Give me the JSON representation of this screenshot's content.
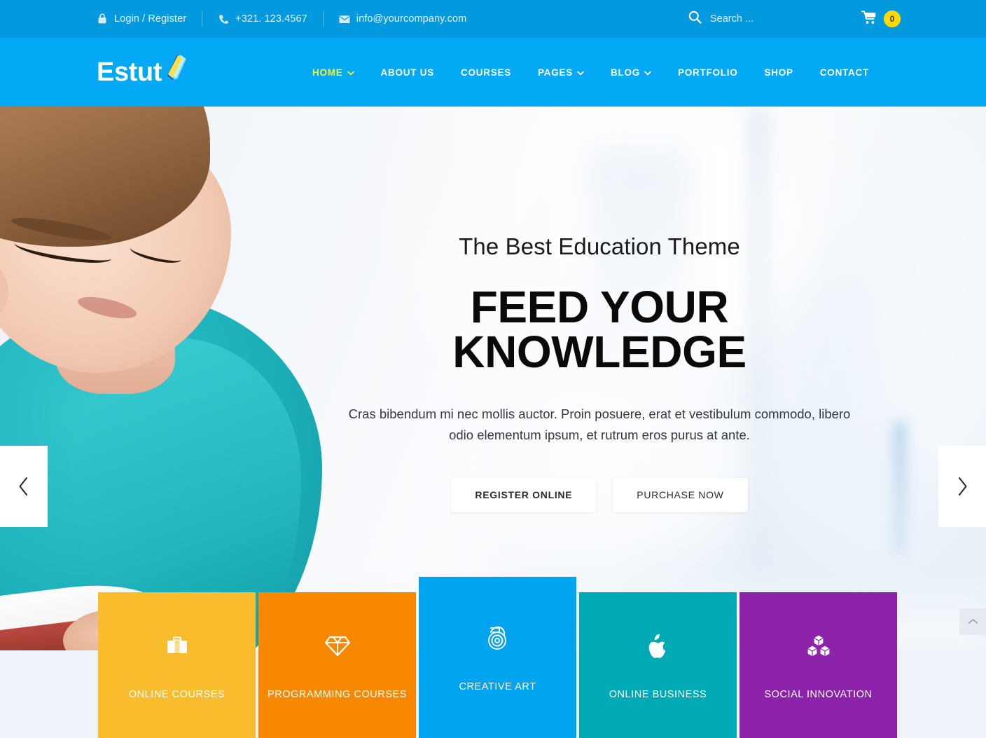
{
  "topbar": {
    "login": "Login / Register",
    "phone": "+321. 123.4567",
    "email": "info@yourcompany.com",
    "search_placeholder": "Search ...",
    "cart_count": "0"
  },
  "header": {
    "logo_text": "Estut",
    "nav": [
      {
        "label": "HOME",
        "active": true,
        "caret": true
      },
      {
        "label": "ABOUT US",
        "active": false,
        "caret": false
      },
      {
        "label": "COURSES",
        "active": false,
        "caret": false
      },
      {
        "label": "PAGES",
        "active": false,
        "caret": true
      },
      {
        "label": "BLOG",
        "active": false,
        "caret": true
      },
      {
        "label": "PORTFOLIO",
        "active": false,
        "caret": false
      },
      {
        "label": "SHOP",
        "active": false,
        "caret": false
      },
      {
        "label": "CONTACT",
        "active": false,
        "caret": false
      }
    ]
  },
  "hero": {
    "subtitle": "The Best Education Theme",
    "title": "FEED YOUR KNOWLEDGE",
    "description": "Cras bibendum mi nec mollis auctor. Proin posuere, erat et vestibulum commodo, libero odio elementum ipsum, et rutrum eros purus at ante.",
    "btn_primary": "REGISTER ONLINE",
    "btn_secondary": "PURCHASE NOW"
  },
  "cards": [
    {
      "label": "ONLINE COURSES",
      "color": "#f9bc2c",
      "icon": "briefcase-icon",
      "raised": false
    },
    {
      "label": "PROGRAMMING COURSES",
      "color": "#f78800",
      "icon": "diamond-icon",
      "raised": false
    },
    {
      "label": "CREATIVE ART",
      "color": "#00a4ef",
      "icon": "fingerprint-icon",
      "raised": true
    },
    {
      "label": "ONLINE BUSINESS",
      "color": "#00aab4",
      "icon": "apple-icon",
      "raised": false
    },
    {
      "label": "SOCIAL INNOVATION",
      "color": "#8e23ab",
      "icon": "cubes-icon",
      "raised": false
    }
  ],
  "colors": {
    "topbar_bg": "#0399de",
    "header_bg": "#03a9f4",
    "nav_active": "#f7ef2e",
    "cart_badge": "#ffd900",
    "page_bg": "#eef2f9"
  }
}
